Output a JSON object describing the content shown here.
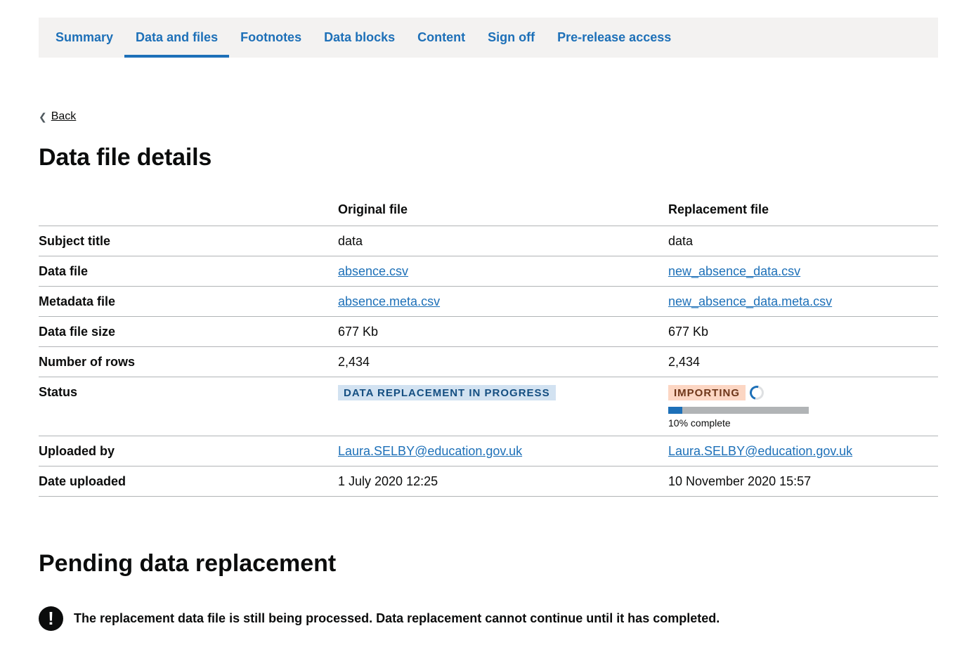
{
  "tabs": [
    {
      "label": "Summary",
      "active": false
    },
    {
      "label": "Data and files",
      "active": true
    },
    {
      "label": "Footnotes",
      "active": false
    },
    {
      "label": "Data blocks",
      "active": false
    },
    {
      "label": "Content",
      "active": false
    },
    {
      "label": "Sign off",
      "active": false
    },
    {
      "label": "Pre-release access",
      "active": false
    }
  ],
  "back_link": "Back",
  "page_title": "Data file details",
  "table": {
    "headers": {
      "original": "Original file",
      "replacement": "Replacement file"
    },
    "rows": {
      "subject_title": {
        "label": "Subject title",
        "original": "data",
        "replacement": "data"
      },
      "data_file": {
        "label": "Data file",
        "original": "absence.csv",
        "replacement": "new_absence_data.csv"
      },
      "metadata_file": {
        "label": "Metadata file",
        "original": "absence.meta.csv",
        "replacement": "new_absence_data.meta.csv"
      },
      "data_file_size": {
        "label": "Data file size",
        "original": "677 Kb",
        "replacement": "677 Kb"
      },
      "number_of_rows": {
        "label": "Number of rows",
        "original": "2,434",
        "replacement": "2,434"
      },
      "status": {
        "label": "Status",
        "original": "DATA REPLACEMENT IN PROGRESS",
        "replacement": "IMPORTING",
        "progress_percent": 10,
        "progress_text": "10% complete"
      },
      "uploaded_by": {
        "label": "Uploaded by",
        "original": "Laura.SELBY@education.gov.uk",
        "replacement": "Laura.SELBY@education.gov.uk"
      },
      "date_uploaded": {
        "label": "Date uploaded",
        "original": "1 July 2020 12:25",
        "replacement": "10 November 2020 15:57"
      }
    }
  },
  "pending_title": "Pending data replacement",
  "warning": {
    "icon": "exclamation-icon",
    "symbol": "!",
    "text": "The replacement data file is still being processed. Data replacement cannot continue until it has completed."
  },
  "colors": {
    "link": "#1d70b8",
    "tab_bg": "#f3f2f1",
    "tag_blue_bg": "#d2e2f1",
    "tag_orange_bg": "#fcd6c3"
  }
}
